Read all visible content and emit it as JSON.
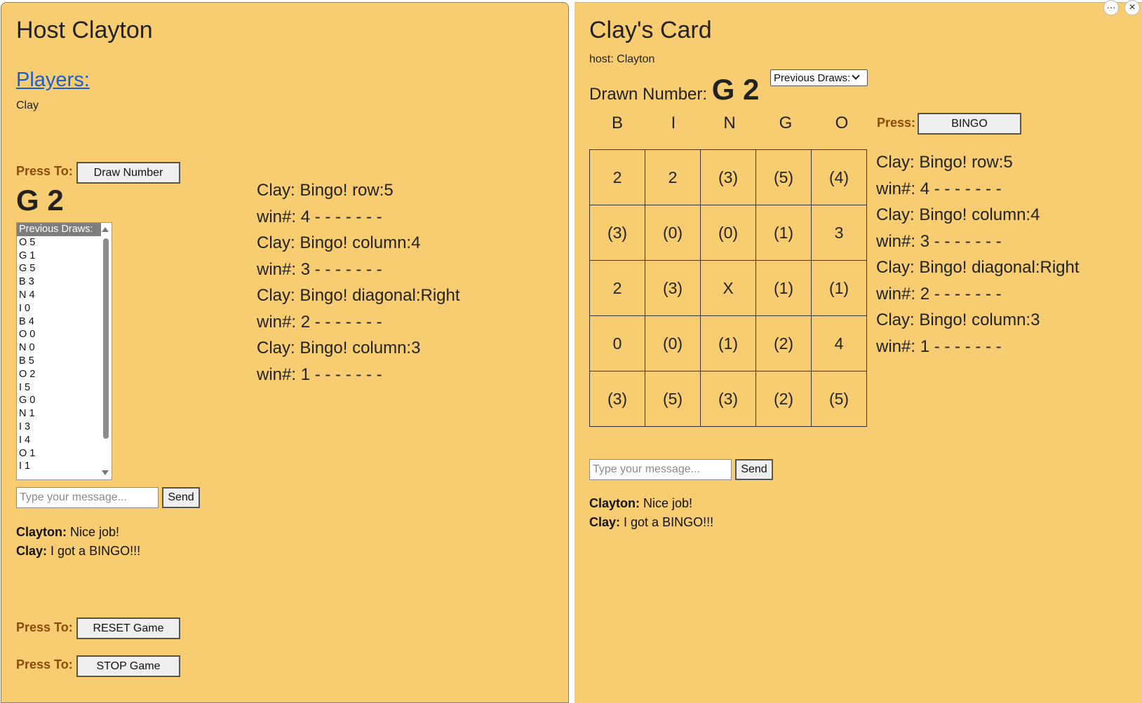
{
  "host": {
    "title": "Host Clayton",
    "players_heading": "Players:",
    "players": [
      "Clay"
    ],
    "press_to_label": "Press To:",
    "draw_button": "Draw Number",
    "current_draw": "G 2",
    "previous_draws_header": "Previous Draws:",
    "previous_draws": [
      "O 5",
      "G 1",
      "G 5",
      "B 3",
      "N 4",
      "I 0",
      "B 4",
      "O 0",
      "N 0",
      "B 5",
      "O 2",
      "I 5",
      "G 0",
      "N 1",
      "I 3",
      "I 4",
      "O 1",
      "I 1"
    ],
    "message_placeholder": "Type your message...",
    "send_button": "Send",
    "chat": [
      {
        "sender": "Clayton:",
        "text": "Nice job!"
      },
      {
        "sender": "Clay:",
        "text": "I got a BINGO!!!"
      }
    ],
    "reset_button": "RESET Game",
    "stop_button": "STOP Game",
    "win_log": [
      "Clay: Bingo! row:5",
      "win#: 4 - - - - - - -",
      "Clay: Bingo! column:4",
      "win#: 3 - - - - - - -",
      "Clay: Bingo! diagonal:Right",
      "win#: 2 - - - - - - -",
      "Clay: Bingo! column:3",
      "win#: 1 - - - - - - -"
    ]
  },
  "player": {
    "title": "Clay's Card",
    "host_line": "host: Clayton",
    "drawn_label": "Drawn Number:",
    "drawn_value": "G 2",
    "previous_draws_select": "Previous Draws:",
    "letters": [
      "B",
      "I",
      "N",
      "G",
      "O"
    ],
    "press_label": "Press:",
    "bingo_button": "BINGO",
    "card": [
      [
        "2",
        "2",
        "(3)",
        "(5)",
        "(4)"
      ],
      [
        "(3)",
        "(0)",
        "(0)",
        "(1)",
        "3"
      ],
      [
        "2",
        "(3)",
        "X",
        "(1)",
        "(1)"
      ],
      [
        "0",
        "(0)",
        "(1)",
        "(2)",
        "4"
      ],
      [
        "(3)",
        "(5)",
        "(3)",
        "(2)",
        "(5)"
      ]
    ],
    "message_placeholder": "Type your message...",
    "send_button": "Send",
    "chat": [
      {
        "sender": "Clayton:",
        "text": "Nice job!"
      },
      {
        "sender": "Clay:",
        "text": "I got a BINGO!!!"
      }
    ],
    "win_log": [
      "Clay: Bingo! row:5",
      "win#: 4 - - - - - - -",
      "Clay: Bingo! column:4",
      "win#: 3 - - - - - - -",
      "Clay: Bingo! diagonal:Right",
      "win#: 2 - - - - - - -",
      "Clay: Bingo! column:3",
      "win#: 1 - - - - - - -"
    ]
  },
  "window_controls": {
    "more": "···",
    "close": "×"
  },
  "colors": {
    "panel_bg": "#f8cd72",
    "press_label": "#8a4a08",
    "link": "#1a5fd0"
  }
}
